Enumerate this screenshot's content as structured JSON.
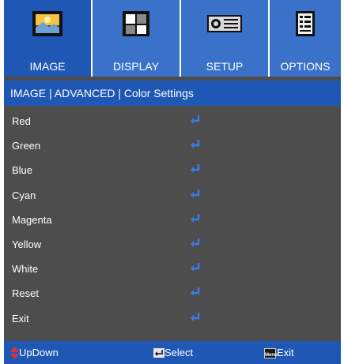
{
  "tabs": [
    {
      "label": "IMAGE",
      "icon": "image-icon",
      "active": true
    },
    {
      "label": "DISPLAY",
      "icon": "display-icon",
      "active": false
    },
    {
      "label": "SETUP",
      "icon": "projector-icon",
      "active": false
    },
    {
      "label": "OPTIONS",
      "icon": "options-icon",
      "active": false
    }
  ],
  "breadcrumb": "IMAGE | ADVANCED | Color Settings",
  "menu": {
    "items": [
      {
        "label": "Red"
      },
      {
        "label": "Green"
      },
      {
        "label": "Blue"
      },
      {
        "label": "Cyan"
      },
      {
        "label": "Magenta"
      },
      {
        "label": "Yellow"
      },
      {
        "label": "White"
      },
      {
        "label": "Reset"
      },
      {
        "label": "Exit"
      }
    ]
  },
  "footer": {
    "updown": "UpDown",
    "select": "Select",
    "menu_key": "Menu",
    "exit": "Exit"
  },
  "colors": {
    "tab_blue": "#3a71c9",
    "active_blue": "#1f58b4",
    "panel_gray": "#4d4d4d",
    "enter_icon": "#3a7ae8",
    "updown_red": "#e53030"
  }
}
